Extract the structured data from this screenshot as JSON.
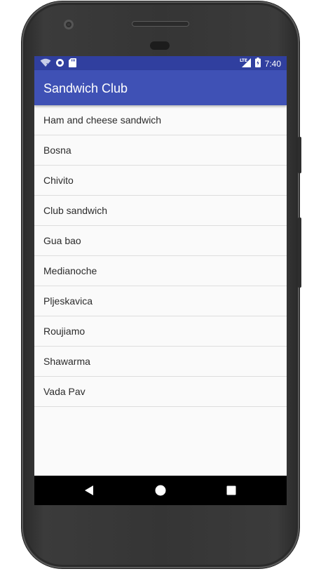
{
  "status_bar": {
    "time": "7:40",
    "network_label": "LTE",
    "color": "#303f9f"
  },
  "app_bar": {
    "title": "Sandwich Club",
    "color": "#3f51b5"
  },
  "sandwiches": [
    "Ham and cheese sandwich",
    "Bosna",
    "Chivito",
    "Club sandwich",
    "Gua bao",
    "Medianoche",
    "Pljeskavica",
    "Roujiamo",
    "Shawarma",
    "Vada Pav"
  ],
  "nav_bar": {
    "back_icon": "back-triangle",
    "home_icon": "home-circle",
    "recents_icon": "recents-square"
  }
}
